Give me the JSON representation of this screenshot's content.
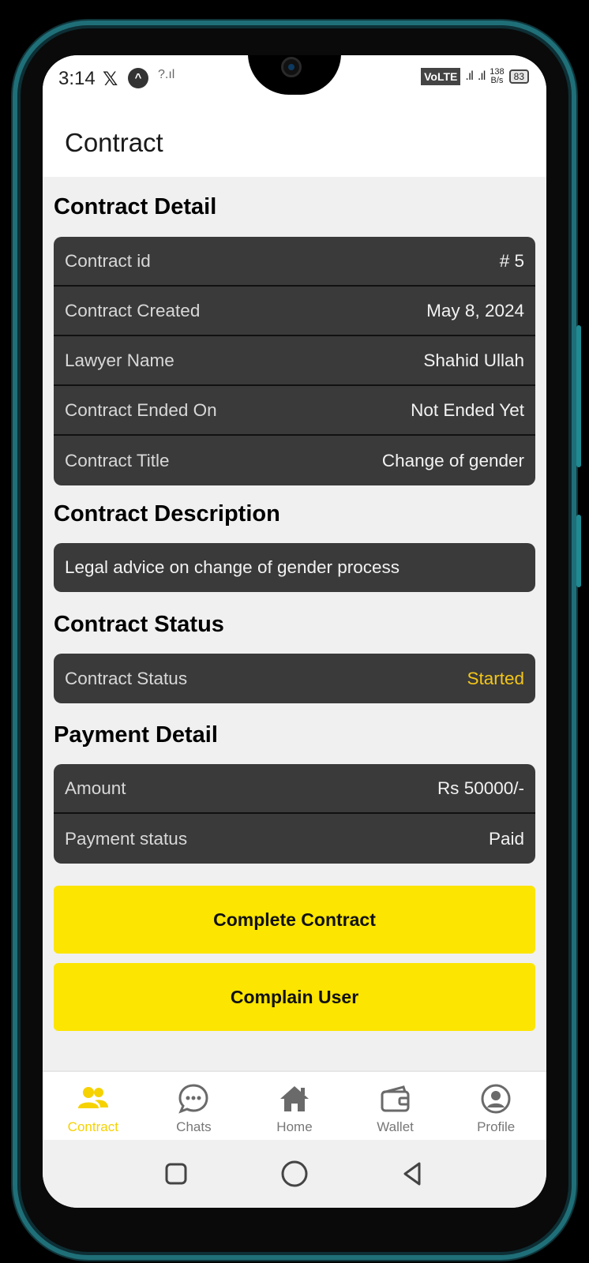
{
  "status_bar": {
    "time": "3:14",
    "x_glyph": "𝕏",
    "a_glyph": "^",
    "q_signal": "?.ıl",
    "volte": "VoLTE",
    "signal1": ".ıl",
    "signal2": ".ıl",
    "speed_value": "138",
    "speed_unit": "B/s",
    "battery": "83"
  },
  "appbar": {
    "title": "Contract"
  },
  "contract_detail": {
    "title": "Contract Detail",
    "rows": [
      {
        "label": "Contract id",
        "value": "# 5"
      },
      {
        "label": "Contract Created",
        "value": "May 8, 2024"
      },
      {
        "label": "Lawyer Name",
        "value": "Shahid Ullah"
      },
      {
        "label": "Contract Ended On",
        "value": "Not Ended Yet"
      },
      {
        "label": "Contract Title",
        "value": "Change of gender"
      }
    ]
  },
  "description": {
    "title": "Contract  Description",
    "text": "Legal advice on change of gender process"
  },
  "status": {
    "title": "Contract Status",
    "label": "Contract Status",
    "value": "Started",
    "value_color": "#f3c619"
  },
  "payment": {
    "title": "Payment Detail",
    "rows": [
      {
        "label": "Amount",
        "value": "Rs 50000/-"
      },
      {
        "label": "Payment status",
        "value": "Paid"
      }
    ]
  },
  "actions": {
    "complete_label": "Complete Contract",
    "complain_label": "Complain User",
    "button_color": "#fce500"
  },
  "bottom_nav": {
    "items": [
      {
        "label": "Contract",
        "icon": "users-icon",
        "active": true
      },
      {
        "label": "Chats",
        "icon": "chat-icon",
        "active": false
      },
      {
        "label": "Home",
        "icon": "home-icon",
        "active": false
      },
      {
        "label": "Wallet",
        "icon": "wallet-icon",
        "active": false
      },
      {
        "label": "Profile",
        "icon": "profile-icon",
        "active": false
      }
    ],
    "active_color": "#f6d200"
  },
  "system_nav": {
    "buttons": [
      "recents-icon",
      "home-circle-icon",
      "back-icon"
    ]
  }
}
